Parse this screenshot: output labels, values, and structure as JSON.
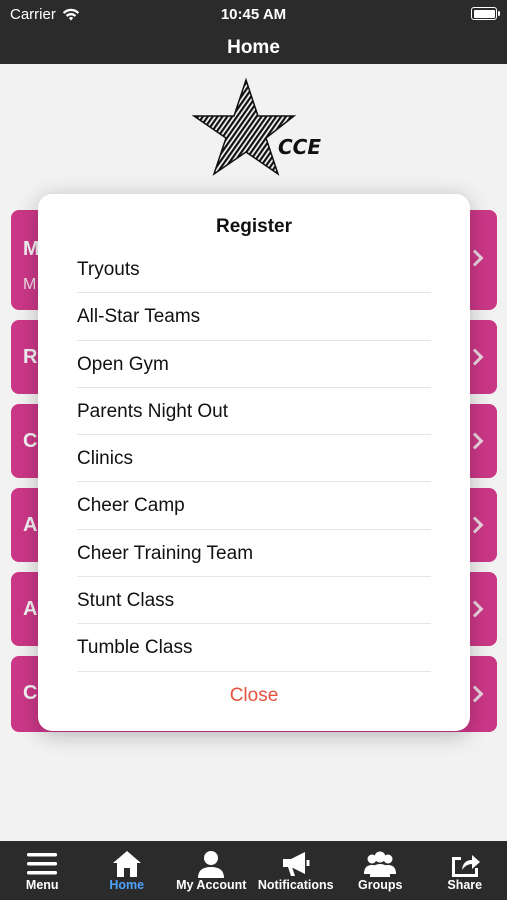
{
  "status": {
    "carrier": "Carrier",
    "time": "10:45 AM"
  },
  "nav": {
    "title": "Home"
  },
  "logo": {
    "text": "CCE"
  },
  "cards": [
    {
      "title": "M",
      "subtitle": "M"
    },
    {
      "title": "R"
    },
    {
      "title": "C"
    },
    {
      "title": "A"
    },
    {
      "title": "A"
    },
    {
      "title": "C"
    }
  ],
  "modal": {
    "title": "Register",
    "items": [
      "Tryouts",
      "All-Star Teams",
      "Open Gym",
      "Parents Night Out",
      "Clinics",
      "Cheer Camp",
      "Cheer Training Team",
      "Stunt Class",
      "Tumble Class"
    ],
    "close_label": "Close"
  },
  "tabs": [
    {
      "label": "Menu",
      "icon": "menu-icon"
    },
    {
      "label": "Home",
      "icon": "home-icon",
      "active": true
    },
    {
      "label": "My Account",
      "icon": "person-icon"
    },
    {
      "label": "Notifications",
      "icon": "megaphone-icon"
    },
    {
      "label": "Groups",
      "icon": "group-icon"
    },
    {
      "label": "Share",
      "icon": "share-icon"
    }
  ],
  "colors": {
    "bar": "#2b2b2b",
    "card": "#d63a8f",
    "close": "#e5533d",
    "active_tab": "#4ea3ff"
  }
}
